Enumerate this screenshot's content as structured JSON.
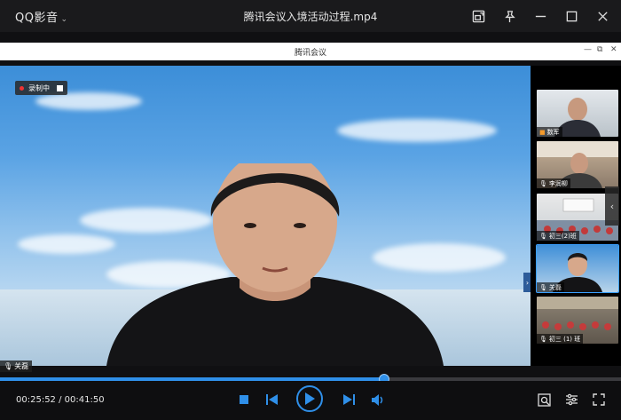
{
  "app": {
    "name": "QQ影音",
    "file_title": "腾讯会议入境活动过程.mp4"
  },
  "meeting": {
    "title": "腾讯会议",
    "recording_label": "录制中",
    "speaker": "关磊"
  },
  "participants": [
    {
      "name": "数军"
    },
    {
      "name": "李润柳"
    },
    {
      "name": "初三(2)班"
    },
    {
      "name": "关磊"
    },
    {
      "name": "初三 (1) 班"
    }
  ],
  "player": {
    "current_time": "00:25:52",
    "separator": " / ",
    "total_time": "00:41:50",
    "progress_fraction": 0.618
  },
  "colors": {
    "accent": "#2f8fe8",
    "titlebar": "#1a1a1c",
    "background": "#101012"
  },
  "icons": {
    "titlebar": [
      "picture-in-picture-icon",
      "pin-icon",
      "minimize-icon",
      "maximize-icon",
      "close-icon"
    ],
    "controls": [
      "stop-icon",
      "previous-icon",
      "play-icon",
      "next-icon",
      "volume-icon",
      "screenshot-icon",
      "settings-icon",
      "fullscreen-icon"
    ]
  }
}
